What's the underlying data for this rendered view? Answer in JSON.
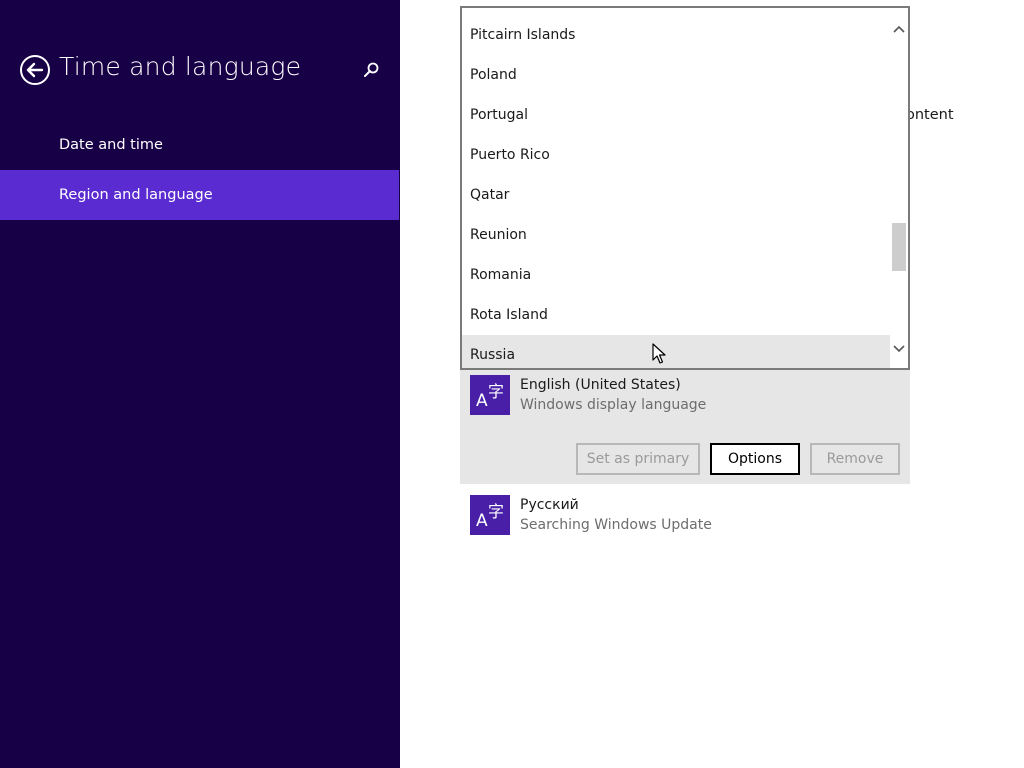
{
  "nav": {
    "title": "Time and language",
    "back_icon": "back-arrow-icon",
    "search_icon": "search-icon",
    "items": [
      {
        "label": "Date and time",
        "selected": false
      },
      {
        "label": "Region and language",
        "selected": true
      }
    ],
    "bg_color": "#180046",
    "accent_color": "#5a2bd0"
  },
  "content": {
    "peek_text": "ontent"
  },
  "country_dropdown": {
    "items": [
      "Pitcairn Islands",
      "Poland",
      "Portugal",
      "Puerto Rico",
      "Qatar",
      "Reunion",
      "Romania",
      "Rota Island",
      "Russia"
    ],
    "hovered": "Russia"
  },
  "languages": [
    {
      "name": "English (United States)",
      "status": "Windows display language",
      "icon": "language-icon",
      "expanded": true,
      "buttons": {
        "set_primary": "Set as primary",
        "options": "Options",
        "remove": "Remove"
      }
    },
    {
      "name": "Русский",
      "status": "Searching Windows Update",
      "icon": "language-icon",
      "expanded": false
    }
  ]
}
